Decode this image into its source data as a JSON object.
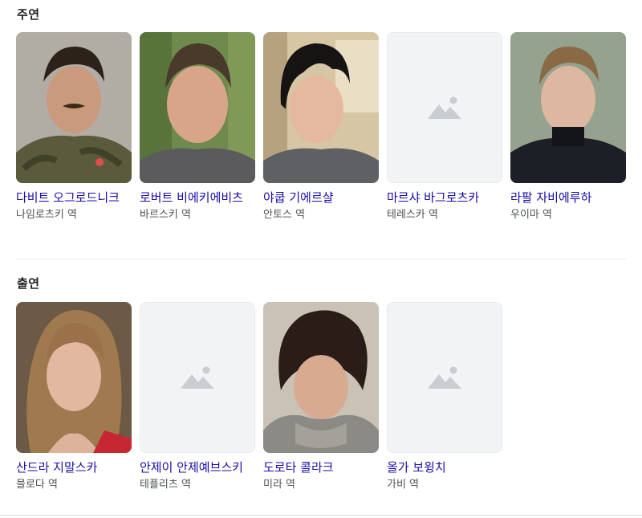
{
  "sections": [
    {
      "title": "주연",
      "cast": [
        {
          "name": "다비트 오그로드니크",
          "role": "나임로츠키 역",
          "photo": "photo"
        },
        {
          "name": "로버트 비에키에비츠",
          "role": "바르스키 역",
          "photo": "photo"
        },
        {
          "name": "야쿱 기에르샬",
          "role": "안토스 역",
          "photo": "photo"
        },
        {
          "name": "마르샤 바그로츠카",
          "role": "테레스카 역",
          "photo": "placeholder"
        },
        {
          "name": "라팔 자비에루하",
          "role": "우이마 역",
          "photo": "photo"
        }
      ]
    },
    {
      "title": "출연",
      "cast": [
        {
          "name": "산드라 지말스카",
          "role": "믈로다 역",
          "photo": "photo"
        },
        {
          "name": "안제이 안제예브스키",
          "role": "테플리츠 역",
          "photo": "placeholder"
        },
        {
          "name": "도로타 콜라크",
          "role": "미라 역",
          "photo": "photo"
        },
        {
          "name": "올가 보윙치",
          "role": "가비 역",
          "photo": "placeholder"
        }
      ]
    }
  ],
  "colors": {
    "link": "#1a0dab",
    "subtext": "#4d5156",
    "placeholder_bg": "#f1f3f4",
    "placeholder_icon": "#c9cdd2"
  }
}
